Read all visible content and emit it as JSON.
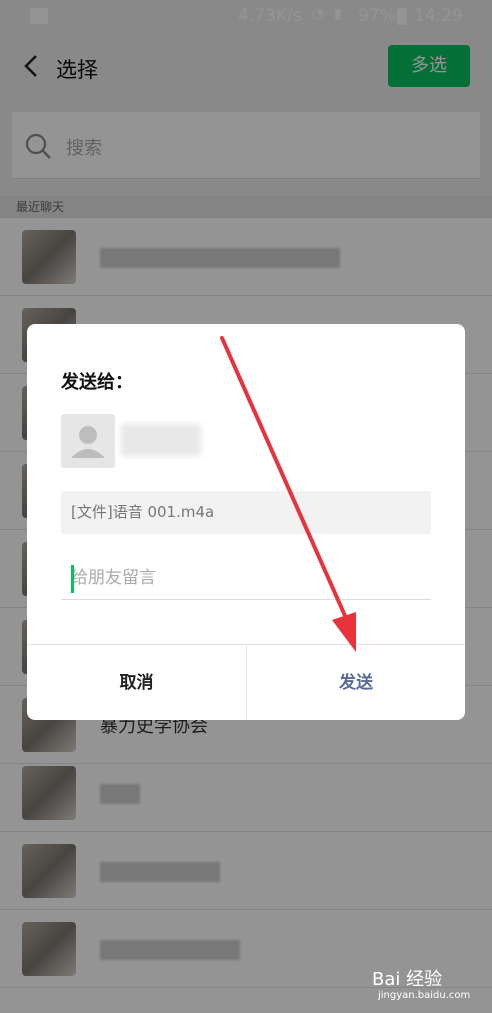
{
  "status_bar": {
    "speed": "4.73K/s",
    "battery": "97%",
    "time": "14:29"
  },
  "header": {
    "title": "选择",
    "multi_select": "多选"
  },
  "search": {
    "placeholder": "搜索"
  },
  "section": {
    "recent": "最近聊天"
  },
  "list": {
    "items": [
      {
        "name": ""
      },
      {
        "name": ""
      },
      {
        "name": ""
      },
      {
        "name": ""
      },
      {
        "name": ""
      },
      {
        "name": ""
      },
      {
        "name": "暴力史学协会"
      },
      {
        "name": ""
      },
      {
        "name": ""
      },
      {
        "name": ""
      }
    ]
  },
  "dialog": {
    "title": "发送给：",
    "file": "[文件]语音 001.m4a",
    "message_placeholder": "给朋友留言",
    "cancel": "取消",
    "send": "发送"
  },
  "watermark": {
    "brand": "Bai 经验",
    "url": "jingyan.baidu.com"
  },
  "colors": {
    "accent": "#07c160",
    "send": "#576b95",
    "arrow": "#e8323c"
  }
}
